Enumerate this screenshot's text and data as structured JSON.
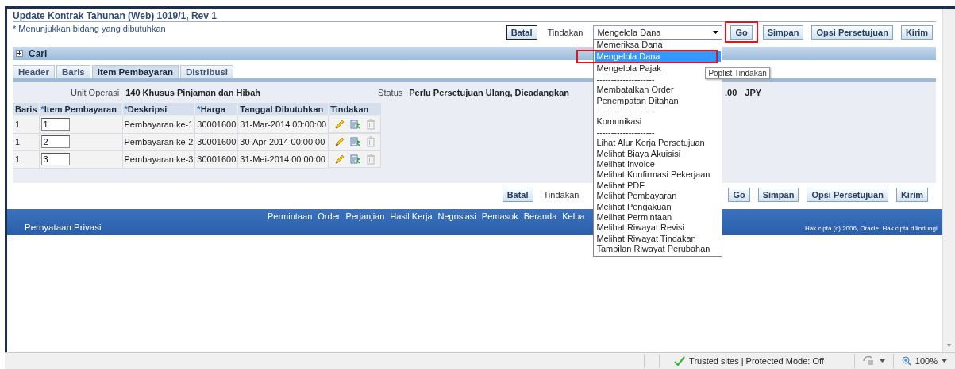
{
  "page": {
    "title": "Update Kontrak Tahunan (Web) 1019/1, Rev 1",
    "required_note": "* Menunjukkan bidang yang dibutuhkan"
  },
  "top_actions": {
    "cancel": "Batal",
    "action_label": "Tindakan",
    "action_value": "Mengelola Dana",
    "go": "Go",
    "go_highlighted": true,
    "save": "Simpan",
    "approval": "Opsi Persetujuan",
    "submit": "Kirim"
  },
  "dropdown": {
    "expanded": true,
    "selection_highlighted": true,
    "tooltip": "Poplist Tindakan",
    "options": [
      {
        "kind": "option",
        "label": "Memeriksa Dana",
        "selected": false
      },
      {
        "kind": "option",
        "label": "Mengelola Dana",
        "selected": true
      },
      {
        "kind": "option",
        "label": "Mengelola Pajak",
        "selected": false
      },
      {
        "kind": "separator",
        "label": "--------------------"
      },
      {
        "kind": "option",
        "label": "Membatalkan Order",
        "selected": false
      },
      {
        "kind": "option",
        "label": "Penempatan Ditahan",
        "selected": false
      },
      {
        "kind": "separator",
        "label": "--------------------"
      },
      {
        "kind": "option",
        "label": "Komunikasi",
        "selected": false
      },
      {
        "kind": "separator",
        "label": "--------------------"
      },
      {
        "kind": "option",
        "label": "Lihat Alur Kerja Persetujuan",
        "selected": false
      },
      {
        "kind": "option",
        "label": "Melihat Biaya Akuisisi",
        "selected": false
      },
      {
        "kind": "option",
        "label": "Melihat Invoice",
        "selected": false
      },
      {
        "kind": "option",
        "label": "Melihat Konfirmasi Pekerjaan",
        "selected": false
      },
      {
        "kind": "option",
        "label": "Melihat PDF",
        "selected": false
      },
      {
        "kind": "option",
        "label": "Melihat Pembayaran",
        "selected": false
      },
      {
        "kind": "option",
        "label": "Melihat Pengakuan",
        "selected": false
      },
      {
        "kind": "option",
        "label": "Melihat Permintaan",
        "selected": false
      },
      {
        "kind": "option",
        "label": "Melihat Riwayat Revisi",
        "selected": false
      },
      {
        "kind": "option",
        "label": "Melihat Riwayat Tindakan",
        "selected": false
      },
      {
        "kind": "option",
        "label": "Tampilan Riwayat Perubahan",
        "selected": false
      }
    ]
  },
  "search_section": {
    "label": "Cari",
    "expanded": false
  },
  "tabs": [
    {
      "label": "Header",
      "selected": false
    },
    {
      "label": "Baris",
      "selected": false
    },
    {
      "label": "Item Pembayaran",
      "selected": true
    },
    {
      "label": "Distribusi",
      "selected": false
    }
  ],
  "summary": {
    "unit_label": "Unit Operasi",
    "unit_value": "140 Khusus Pinjaman dan Hibah",
    "status_label": "Status",
    "status_value": "Perlu Persetujuan Ulang, Dicadangkan",
    "amount_partial": ".00",
    "currency": "JPY"
  },
  "table": {
    "columns": [
      {
        "label": "Baris"
      },
      {
        "marker": "*",
        "label": "Item Pembayaran"
      },
      {
        "marker": "*",
        "label": "Deskripsi"
      },
      {
        "marker": "*",
        "label": "Harga"
      },
      {
        "label": "Tanggal Dibutuhkan"
      },
      {
        "label": "Tindakan"
      }
    ],
    "rows": [
      {
        "line": "1",
        "item": "1",
        "description": "Pembayaran ke-1",
        "price": "30001600",
        "date": "31-Mar-2014 00:00:00",
        "can_delete": false
      },
      {
        "line": "1",
        "item": "2",
        "description": "Pembayaran ke-2",
        "price": "30001600",
        "date": "30-Apr-2014 00:00:00",
        "can_delete": false
      },
      {
        "line": "1",
        "item": "3",
        "description": "Pembayaran ke-3",
        "price": "30001600",
        "date": "31-Mei-2014 00:00:00",
        "can_delete": false
      }
    ]
  },
  "bottom_actions": {
    "cancel": "Batal",
    "action_label": "Tindakan",
    "go": "Go",
    "save": "Simpan",
    "approval": "Opsi Persetujuan",
    "submit": "Kirim"
  },
  "footer": {
    "links": [
      "Permintaan",
      "Order",
      "Perjanjian",
      "Hasil Kerja",
      "Negosiasi",
      "Pemasok",
      "Beranda",
      "Kelua"
    ],
    "privacy": "Pernyataan Privasi",
    "copyright": "Hak cipta (c) 2006, Oracle. Hak cipta dilindungi."
  },
  "status_bar": {
    "zone": "Trusted sites | Protected Mode: Off",
    "zoom": "100%"
  }
}
